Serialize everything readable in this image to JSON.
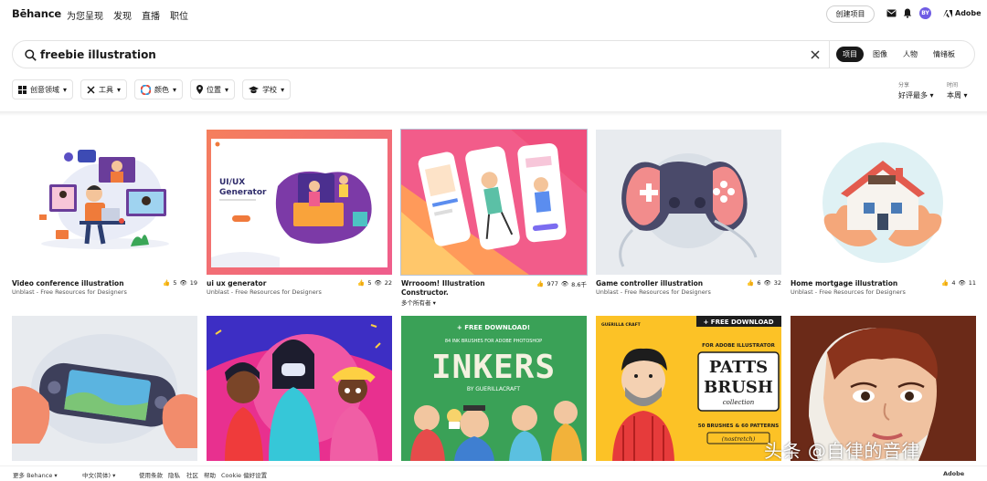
{
  "brand": {
    "logo": "Bēhance"
  },
  "nav": {
    "items": [
      "为您呈现",
      "发现",
      "直播",
      "职位"
    ]
  },
  "header": {
    "create_label": "创建项目",
    "adobe_label": "Adobe",
    "avatar_initials": "BY"
  },
  "search": {
    "value": "freebie illustration",
    "tabs": [
      {
        "label": "项目",
        "active": true
      },
      {
        "label": "图像",
        "active": false
      },
      {
        "label": "人物",
        "active": false
      },
      {
        "label": "情绪板",
        "active": false
      }
    ]
  },
  "filters": {
    "items": [
      "创意领域",
      "工具",
      "颜色",
      "位置",
      "学校"
    ],
    "sort": {
      "label": "分享",
      "value": "好评最多"
    },
    "time": {
      "label": "时间",
      "value": "本周"
    }
  },
  "projects": [
    {
      "title": "Video conference illustration",
      "owner": "Unblast - Free Resources for Designers",
      "likes": "5",
      "views": "19"
    },
    {
      "title": "ui ux generator",
      "owner": "Unblast - Free Resources for Designers",
      "likes": "5",
      "views": "22"
    },
    {
      "title": "Wrrooom! Illustration Constructor.",
      "owner": "多个所有者",
      "likes": "977",
      "views": "8.6千"
    },
    {
      "title": "Game controller illustration",
      "owner": "Unblast - Free Resources for Designers",
      "likes": "6",
      "views": "32"
    },
    {
      "title": "Home mortgage illustration",
      "owner": "Unblast - Free Resources for Designers",
      "likes": "4",
      "views": "11"
    }
  ],
  "thumb_text": {
    "uiux_title": "UI/UX",
    "uiux_sub": "Generator",
    "free_dl": "+ FREE DOWNLOAD!",
    "inkers_sub": "84 INK BRUSHES FOR ADOBE PHOTOSHOP",
    "inkers": "INKERS",
    "inkers_by": "BY GUERILLACRAFT",
    "free_dl2": "+ FREE DOWNLOAD",
    "guerilla": "GUERILLA CRAFT",
    "patts_for": "FOR ADOBE ILLUSTRATOR",
    "patts1": "PATTS",
    "patts2": "BRUSH",
    "patts3": "collection",
    "patts_count": "50 BRUSHES & 60 PATTERNS",
    "patts_tag": "(nostretch)"
  },
  "footer": {
    "items": [
      "更多 Behance",
      "中文(简体)",
      "使用条款",
      "隐私",
      "社区",
      "帮助",
      "Cookie 偏好设置"
    ],
    "adobe": "Adobe"
  },
  "watermark": "头条 @自律的音律",
  "colors": {
    "accent": "#191919",
    "avatar": "#6f5ce4",
    "border": "#e3e3e3"
  }
}
